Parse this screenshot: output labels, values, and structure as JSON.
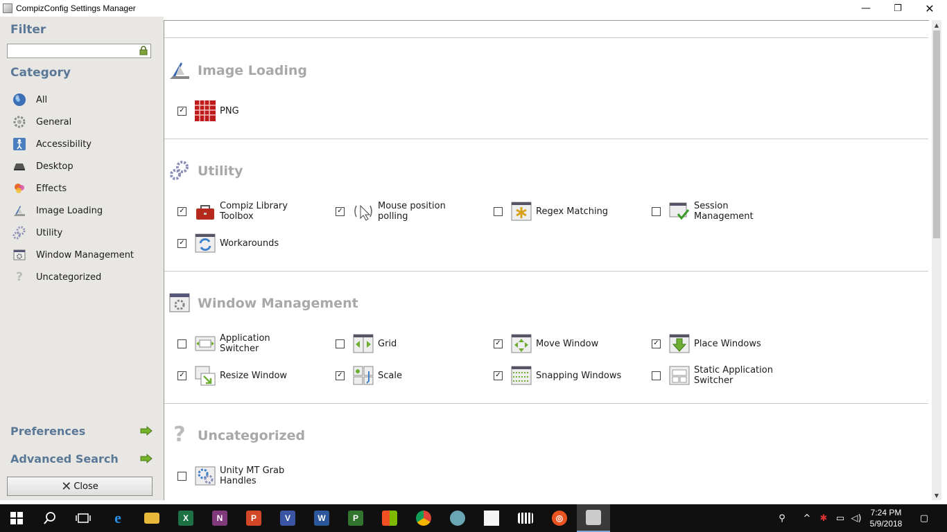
{
  "window": {
    "title": "CompizConfig Settings Manager",
    "minimize": "—",
    "restore": "❐",
    "close": "✕"
  },
  "sidebar": {
    "filter_heading": "Filter",
    "filter_value": "",
    "category_heading": "Category",
    "categories": [
      {
        "label": "All",
        "icon": "globe-icon"
      },
      {
        "label": "General",
        "icon": "gear-icon"
      },
      {
        "label": "Accessibility",
        "icon": "accessibility-icon"
      },
      {
        "label": "Desktop",
        "icon": "desktop-icon"
      },
      {
        "label": "Effects",
        "icon": "effects-icon"
      },
      {
        "label": "Image Loading",
        "icon": "image-loading-icon"
      },
      {
        "label": "Utility",
        "icon": "utility-icon"
      },
      {
        "label": "Window Management",
        "icon": "window-management-icon"
      },
      {
        "label": "Uncategorized",
        "icon": "question-icon"
      }
    ],
    "preferences": "Preferences",
    "advanced_search": "Advanced Search",
    "close": "Close"
  },
  "sections": {
    "image_loading": {
      "title": "Image Loading",
      "plugins": [
        {
          "label": "PNG",
          "checked": true,
          "icon": "png-icon"
        }
      ]
    },
    "utility": {
      "title": "Utility",
      "plugins": [
        {
          "label": "Compiz Library Toolbox",
          "checked": true,
          "icon": "toolbox-icon"
        },
        {
          "label": "Mouse position polling",
          "checked": true,
          "icon": "mouse-polling-icon"
        },
        {
          "label": "Regex Matching",
          "checked": false,
          "icon": "regex-icon"
        },
        {
          "label": "Session Management",
          "checked": false,
          "icon": "session-icon"
        },
        {
          "label": "Workarounds",
          "checked": true,
          "icon": "workarounds-icon"
        }
      ]
    },
    "window_management": {
      "title": "Window Management",
      "plugins": [
        {
          "label": "Application Switcher",
          "checked": false,
          "icon": "app-switcher-icon"
        },
        {
          "label": "Grid",
          "checked": false,
          "icon": "grid-icon"
        },
        {
          "label": "Move Window",
          "checked": true,
          "icon": "move-window-icon"
        },
        {
          "label": "Place Windows",
          "checked": true,
          "icon": "place-windows-icon"
        },
        {
          "label": "Resize Window",
          "checked": true,
          "icon": "resize-window-icon"
        },
        {
          "label": "Scale",
          "checked": true,
          "icon": "scale-icon"
        },
        {
          "label": "Snapping Windows",
          "checked": true,
          "icon": "snapping-icon"
        },
        {
          "label": "Static Application Switcher",
          "checked": false,
          "icon": "static-switcher-icon"
        }
      ]
    },
    "uncategorized": {
      "title": "Uncategorized",
      "plugins": [
        {
          "label": "Unity MT Grab Handles",
          "checked": false,
          "icon": "grab-handles-icon"
        }
      ]
    }
  },
  "taskbar": {
    "time": "7:24 PM",
    "date": "5/9/2018",
    "apps": [
      "start-icon",
      "search-icon",
      "task-view-icon",
      "edge-icon",
      "file-explorer-icon",
      "excel-icon",
      "onenote-icon",
      "powerpoint-icon",
      "visio-icon",
      "word-icon",
      "project-icon",
      "store-icon",
      "chrome-icon",
      "atom-icon",
      "sticky-notes-icon",
      "video-icon",
      "ubuntu-icon",
      "compiz-icon"
    ]
  },
  "colors": {
    "heading": "#5a7896",
    "section_title": "#a8a8a8",
    "sidebar_bg": "#e9e7e3",
    "taskbar_bg": "#101010"
  }
}
